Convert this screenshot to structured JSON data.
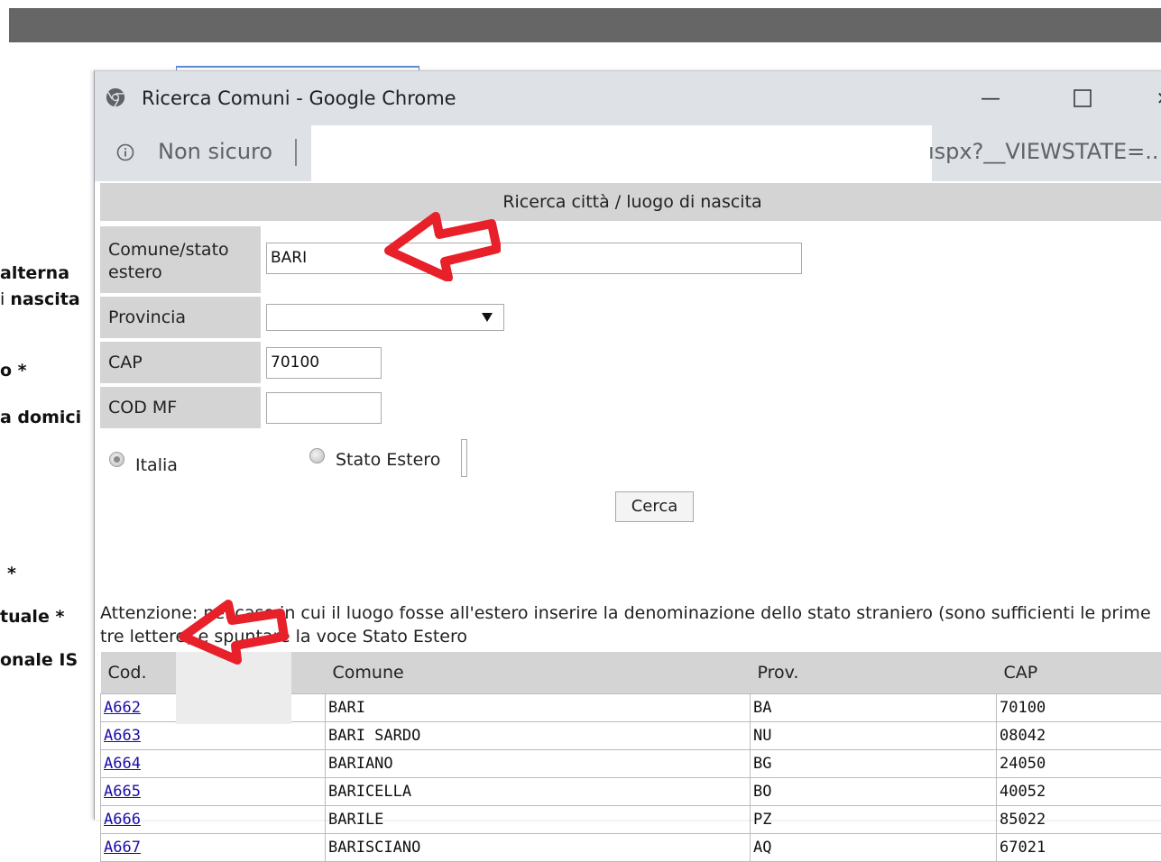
{
  "background_page": {
    "labels": [
      "alterna",
      "nascita",
      "o *",
      "a domici",
      "*",
      "tuale *",
      "onale IS"
    ]
  },
  "window": {
    "title": "Ricerca Comuni - Google Chrome",
    "minimize_glyph": "—",
    "maximize_glyph": "☐",
    "close_glyph": "✕"
  },
  "address": {
    "security_label": "Non sicuro",
    "url_tail": "ıspx?__VIEWSTATE=..."
  },
  "form": {
    "header": "Ricerca città / luogo di nascita",
    "comune_label": "Comune/stato estero",
    "comune_value": "BARI",
    "provincia_label": "Provincia",
    "provincia_value": "",
    "cap_label": "CAP",
    "cap_value": "70100",
    "codmf_label": "COD MF",
    "codmf_value": "",
    "radio_italia": "Italia",
    "radio_estero": "Stato Estero",
    "selected_radio": "Italia",
    "search_button": "Cerca",
    "notice": "Attenzione: nel caso in cui il luogo fosse all'estero inserire la denominazione dello stato straniero (sono sufficienti le prime tre lettere) e spuntare la voce Stato Estero"
  },
  "results": {
    "headers": [
      "Cod.",
      "Comune",
      "Prov.",
      "CAP"
    ],
    "rows": [
      {
        "cod": "A662",
        "comune": "BARI",
        "prov": "BA",
        "cap": "70100"
      },
      {
        "cod": "A663",
        "comune": "BARI SARDO",
        "prov": "NU",
        "cap": "08042"
      },
      {
        "cod": "A664",
        "comune": "BARIANO",
        "prov": "BG",
        "cap": "24050"
      },
      {
        "cod": "A665",
        "comune": "BARICELLA",
        "prov": "BO",
        "cap": "40052"
      },
      {
        "cod": "A666",
        "comune": "BARILE",
        "prov": "PZ",
        "cap": "85022"
      },
      {
        "cod": "A667",
        "comune": "BARISCIANO",
        "prov": "AQ",
        "cap": "67021"
      }
    ]
  },
  "colors": {
    "annotation_arrow": "#e8202a",
    "link": "#1a0dab",
    "label_bg": "#d4d4d4",
    "titlebar_bg": "#dee1e6",
    "top_bar": "#666666"
  },
  "icons": {
    "chrome": "chrome-icon",
    "info": "info-icon",
    "dropdown": "chevron-down-icon",
    "annotation": "arrow-icon"
  }
}
